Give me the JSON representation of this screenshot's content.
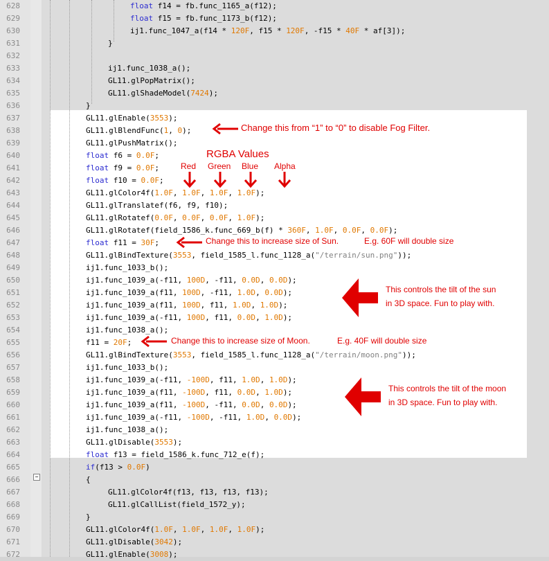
{
  "lines": [
    {
      "num": "628",
      "indent": 188,
      "tokens": [
        [
          "kw",
          "float"
        ],
        [
          "t",
          " f14 = fb.func_1165_a(f12);"
        ]
      ]
    },
    {
      "num": "629",
      "indent": 188,
      "tokens": [
        [
          "kw",
          "float"
        ],
        [
          "t",
          " f15 = fb.func_1173_b(f12);"
        ]
      ]
    },
    {
      "num": "630",
      "indent": 188,
      "tokens": [
        [
          "t",
          "ij1.func_1047_a(f14 * "
        ],
        [
          "num",
          "120F"
        ],
        [
          "t",
          ", f15 * "
        ],
        [
          "num",
          "120F"
        ],
        [
          "t",
          ", -f15 * "
        ],
        [
          "num",
          "40F"
        ],
        [
          "t",
          " * af[3]);"
        ]
      ]
    },
    {
      "num": "631",
      "indent": 156,
      "tokens": [
        [
          "t",
          "}"
        ]
      ]
    },
    {
      "num": "632",
      "indent": 156,
      "tokens": []
    },
    {
      "num": "633",
      "indent": 156,
      "tokens": [
        [
          "t",
          "ij1.func_1038_a();"
        ]
      ]
    },
    {
      "num": "634",
      "indent": 156,
      "tokens": [
        [
          "t",
          "GL11.glPopMatrix();"
        ]
      ]
    },
    {
      "num": "635",
      "indent": 156,
      "tokens": [
        [
          "t",
          "GL11.glShadeModel("
        ],
        [
          "num",
          "7424"
        ],
        [
          "t",
          ");"
        ]
      ]
    },
    {
      "num": "636",
      "indent": 124,
      "tokens": [
        [
          "t",
          "}"
        ]
      ]
    },
    {
      "num": "637",
      "indent": 124,
      "tokens": [
        [
          "t",
          "GL11.glEnable("
        ],
        [
          "num",
          "3553"
        ],
        [
          "t",
          ");"
        ]
      ]
    },
    {
      "num": "638",
      "indent": 124,
      "tokens": [
        [
          "t",
          "GL11.glBlendFunc("
        ],
        [
          "num",
          "1"
        ],
        [
          "t",
          ", "
        ],
        [
          "num",
          "0"
        ],
        [
          "t",
          ");"
        ]
      ]
    },
    {
      "num": "639",
      "indent": 124,
      "tokens": [
        [
          "t",
          "GL11.glPushMatrix();"
        ]
      ]
    },
    {
      "num": "640",
      "indent": 124,
      "tokens": [
        [
          "kw",
          "float"
        ],
        [
          "t",
          " f6 = "
        ],
        [
          "num",
          "0.0F"
        ],
        [
          "t",
          ";"
        ]
      ]
    },
    {
      "num": "641",
      "indent": 124,
      "tokens": [
        [
          "kw",
          "float"
        ],
        [
          "t",
          " f9 = "
        ],
        [
          "num",
          "0.0F"
        ],
        [
          "t",
          ";"
        ]
      ]
    },
    {
      "num": "642",
      "indent": 124,
      "tokens": [
        [
          "kw",
          "float"
        ],
        [
          "t",
          " f10 = "
        ],
        [
          "num",
          "0.0F"
        ],
        [
          "t",
          ";"
        ]
      ]
    },
    {
      "num": "643",
      "indent": 124,
      "tokens": [
        [
          "t",
          "GL11.glColor4f("
        ],
        [
          "num",
          "1.0F"
        ],
        [
          "t",
          ", "
        ],
        [
          "num",
          "1.0F"
        ],
        [
          "t",
          ", "
        ],
        [
          "num",
          "1.0F"
        ],
        [
          "t",
          ", "
        ],
        [
          "num",
          "1.0F"
        ],
        [
          "t",
          ");"
        ]
      ]
    },
    {
      "num": "644",
      "indent": 124,
      "tokens": [
        [
          "t",
          "GL11.glTranslatef(f6, f9, f10);"
        ]
      ]
    },
    {
      "num": "645",
      "indent": 124,
      "tokens": [
        [
          "t",
          "GL11.glRotatef("
        ],
        [
          "num",
          "0.0F"
        ],
        [
          "t",
          ", "
        ],
        [
          "num",
          "0.0F"
        ],
        [
          "t",
          ", "
        ],
        [
          "num",
          "0.0F"
        ],
        [
          "t",
          ", "
        ],
        [
          "num",
          "1.0F"
        ],
        [
          "t",
          ");"
        ]
      ]
    },
    {
      "num": "646",
      "indent": 124,
      "tokens": [
        [
          "t",
          "GL11.glRotatef(field_1586_k.func_669_b(f) * "
        ],
        [
          "num",
          "360F"
        ],
        [
          "t",
          ", "
        ],
        [
          "num",
          "1.0F"
        ],
        [
          "t",
          ", "
        ],
        [
          "num",
          "0.0F"
        ],
        [
          "t",
          ", "
        ],
        [
          "num",
          "0.0F"
        ],
        [
          "t",
          ");"
        ]
      ]
    },
    {
      "num": "647",
      "indent": 124,
      "tokens": [
        [
          "kw",
          "float"
        ],
        [
          "t",
          " f11 = "
        ],
        [
          "num",
          "30F"
        ],
        [
          "t",
          ";"
        ]
      ]
    },
    {
      "num": "648",
      "indent": 124,
      "tokens": [
        [
          "t",
          "GL11.glBindTexture("
        ],
        [
          "num",
          "3553"
        ],
        [
          "t",
          ", field_1585_l.func_1128_a("
        ],
        [
          "str",
          "\"/terrain/sun.png\""
        ],
        [
          "t",
          "));"
        ]
      ]
    },
    {
      "num": "649",
      "indent": 124,
      "tokens": [
        [
          "t",
          "ij1.func_1033_b();"
        ]
      ]
    },
    {
      "num": "650",
      "indent": 124,
      "tokens": [
        [
          "t",
          "ij1.func_1039_a(-f11, "
        ],
        [
          "num",
          "100D"
        ],
        [
          "t",
          ", -f11, "
        ],
        [
          "num",
          "0.0D"
        ],
        [
          "t",
          ", "
        ],
        [
          "num",
          "0.0D"
        ],
        [
          "t",
          ");"
        ]
      ]
    },
    {
      "num": "651",
      "indent": 124,
      "tokens": [
        [
          "t",
          "ij1.func_1039_a(f11, "
        ],
        [
          "num",
          "100D"
        ],
        [
          "t",
          ", -f11, "
        ],
        [
          "num",
          "1.0D"
        ],
        [
          "t",
          ", "
        ],
        [
          "num",
          "0.0D"
        ],
        [
          "t",
          ");"
        ]
      ]
    },
    {
      "num": "652",
      "indent": 124,
      "tokens": [
        [
          "t",
          "ij1.func_1039_a(f11, "
        ],
        [
          "num",
          "100D"
        ],
        [
          "t",
          ", f11, "
        ],
        [
          "num",
          "1.0D"
        ],
        [
          "t",
          ", "
        ],
        [
          "num",
          "1.0D"
        ],
        [
          "t",
          ");"
        ]
      ]
    },
    {
      "num": "653",
      "indent": 124,
      "tokens": [
        [
          "t",
          "ij1.func_1039_a(-f11, "
        ],
        [
          "num",
          "100D"
        ],
        [
          "t",
          ", f11, "
        ],
        [
          "num",
          "0.0D"
        ],
        [
          "t",
          ", "
        ],
        [
          "num",
          "1.0D"
        ],
        [
          "t",
          ");"
        ]
      ]
    },
    {
      "num": "654",
      "indent": 124,
      "tokens": [
        [
          "t",
          "ij1.func_1038_a();"
        ]
      ]
    },
    {
      "num": "655",
      "indent": 124,
      "tokens": [
        [
          "t",
          "f11 = "
        ],
        [
          "num",
          "20F"
        ],
        [
          "t",
          ";"
        ]
      ]
    },
    {
      "num": "656",
      "indent": 124,
      "tokens": [
        [
          "t",
          "GL11.glBindTexture("
        ],
        [
          "num",
          "3553"
        ],
        [
          "t",
          ", field_1585_l.func_1128_a("
        ],
        [
          "str",
          "\"/terrain/moon.png\""
        ],
        [
          "t",
          "));"
        ]
      ]
    },
    {
      "num": "657",
      "indent": 124,
      "tokens": [
        [
          "t",
          "ij1.func_1033_b();"
        ]
      ]
    },
    {
      "num": "658",
      "indent": 124,
      "tokens": [
        [
          "t",
          "ij1.func_1039_a(-f11, "
        ],
        [
          "num",
          "-100D"
        ],
        [
          "t",
          ", f11, "
        ],
        [
          "num",
          "1.0D"
        ],
        [
          "t",
          ", "
        ],
        [
          "num",
          "1.0D"
        ],
        [
          "t",
          ");"
        ]
      ]
    },
    {
      "num": "659",
      "indent": 124,
      "tokens": [
        [
          "t",
          "ij1.func_1039_a(f11, "
        ],
        [
          "num",
          "-100D"
        ],
        [
          "t",
          ", f11, "
        ],
        [
          "num",
          "0.0D"
        ],
        [
          "t",
          ", "
        ],
        [
          "num",
          "1.0D"
        ],
        [
          "t",
          ");"
        ]
      ]
    },
    {
      "num": "660",
      "indent": 124,
      "tokens": [
        [
          "t",
          "ij1.func_1039_a(f11, "
        ],
        [
          "num",
          "-100D"
        ],
        [
          "t",
          ", -f11, "
        ],
        [
          "num",
          "0.0D"
        ],
        [
          "t",
          ", "
        ],
        [
          "num",
          "0.0D"
        ],
        [
          "t",
          ");"
        ]
      ]
    },
    {
      "num": "661",
      "indent": 124,
      "tokens": [
        [
          "t",
          "ij1.func_1039_a(-f11, "
        ],
        [
          "num",
          "-100D"
        ],
        [
          "t",
          ", -f11, "
        ],
        [
          "num",
          "1.0D"
        ],
        [
          "t",
          ", "
        ],
        [
          "num",
          "0.0D"
        ],
        [
          "t",
          ");"
        ]
      ]
    },
    {
      "num": "662",
      "indent": 124,
      "tokens": [
        [
          "t",
          "ij1.func_1038_a();"
        ]
      ]
    },
    {
      "num": "663",
      "indent": 124,
      "tokens": [
        [
          "t",
          "GL11.glDisable("
        ],
        [
          "num",
          "3553"
        ],
        [
          "t",
          ");"
        ]
      ]
    },
    {
      "num": "664",
      "indent": 124,
      "tokens": [
        [
          "kw",
          "float"
        ],
        [
          "t",
          " f13 = field_1586_k.func_712_e(f);"
        ]
      ]
    },
    {
      "num": "665",
      "indent": 124,
      "tokens": [
        [
          "kw",
          "if"
        ],
        [
          "t",
          "(f13 > "
        ],
        [
          "num",
          "0.0F"
        ],
        [
          "t",
          ")"
        ]
      ]
    },
    {
      "num": "666",
      "indent": 124,
      "tokens": [
        [
          "t",
          "{"
        ]
      ]
    },
    {
      "num": "667",
      "indent": 156,
      "tokens": [
        [
          "t",
          "GL11.glColor4f(f13, f13, f13, f13);"
        ]
      ]
    },
    {
      "num": "668",
      "indent": 156,
      "tokens": [
        [
          "t",
          "GL11.glCallList(field_1572_y);"
        ]
      ]
    },
    {
      "num": "669",
      "indent": 124,
      "tokens": [
        [
          "t",
          "}"
        ]
      ]
    },
    {
      "num": "670",
      "indent": 124,
      "tokens": [
        [
          "t",
          "GL11.glColor4f("
        ],
        [
          "num",
          "1.0F"
        ],
        [
          "t",
          ", "
        ],
        [
          "num",
          "1.0F"
        ],
        [
          "t",
          ", "
        ],
        [
          "num",
          "1.0F"
        ],
        [
          "t",
          ", "
        ],
        [
          "num",
          "1.0F"
        ],
        [
          "t",
          ");"
        ]
      ]
    },
    {
      "num": "671",
      "indent": 124,
      "tokens": [
        [
          "t",
          "GL11.glDisable("
        ],
        [
          "num",
          "3042"
        ],
        [
          "t",
          ");"
        ]
      ]
    },
    {
      "num": "672",
      "indent": 124,
      "tokens": [
        [
          "t",
          "GL11.glEnable("
        ],
        [
          "num",
          "3008"
        ],
        [
          "t",
          ");"
        ]
      ]
    }
  ],
  "annotations": {
    "fog": "Change this from “1” to “0” to disable Fog Filter.",
    "rgba_title": "RGBA Values",
    "red": "Red",
    "green": "Green",
    "blue": "Blue",
    "alpha": "Alpha",
    "sun_size": "Change this to increase size of Sun.",
    "sun_example": "E.g. 60F will double size",
    "sun_tilt_1": "This controls the tilt of the sun",
    "sun_tilt_2": "in 3D space. Fun to play with.",
    "moon_size": "Change this to increase size of Moon.",
    "moon_example": "E.g. 40F will double size",
    "moon_tilt_1": "This controls the tilt of the moon",
    "moon_tilt_2": "in 3D space. Fun to play with."
  },
  "colors": {
    "keyword": "#2c2cd0",
    "number": "#e07800",
    "string": "#808080",
    "annotation": "#e00000",
    "highlight": "#ffffff"
  },
  "fold_marker": "−"
}
